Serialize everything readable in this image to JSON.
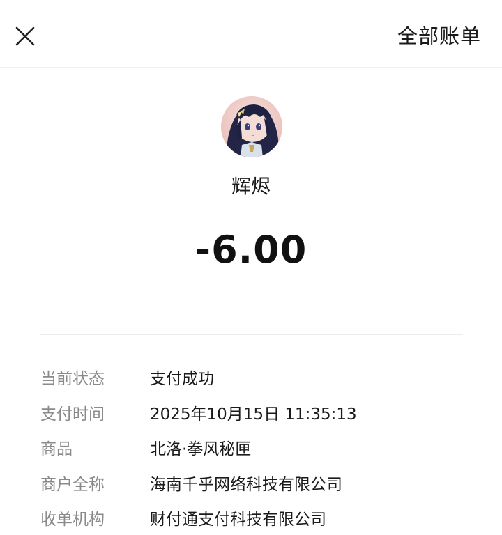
{
  "header": {
    "close_icon": "close-icon",
    "all_bills_label": "全部账单"
  },
  "merchant": {
    "avatar": "merchant-avatar",
    "name": "辉烬"
  },
  "transaction": {
    "amount": "-6.00"
  },
  "details": [
    {
      "label": "当前状态",
      "value": "支付成功"
    },
    {
      "label": "支付时间",
      "value": "2025年10月15日 11:35:13"
    },
    {
      "label": "商品",
      "value": "北洛·拳风秘匣"
    },
    {
      "label": "商户全称",
      "value": "海南千乎网络科技有限公司"
    },
    {
      "label": "收单机构",
      "value": "财付通支付科技有限公司"
    }
  ]
}
